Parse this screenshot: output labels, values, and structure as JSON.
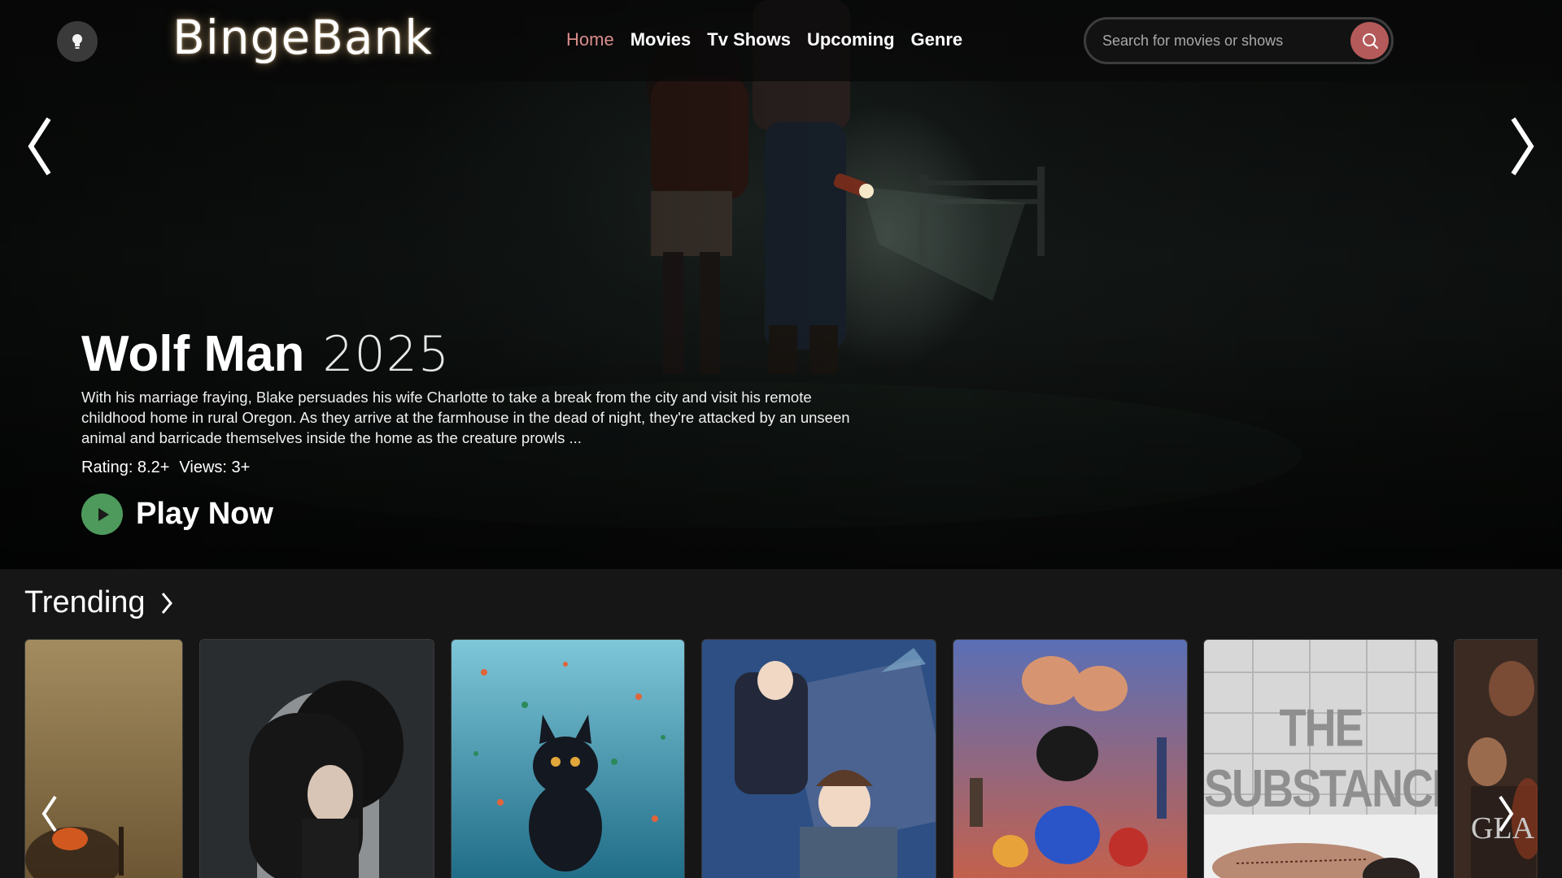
{
  "app": {
    "logo": "BingeBank"
  },
  "nav": {
    "links": [
      {
        "label": "Home",
        "active": true
      },
      {
        "label": "Movies"
      },
      {
        "label": "Tv Shows"
      },
      {
        "label": "Upcoming"
      },
      {
        "label": "Genre"
      }
    ],
    "search_placeholder": "Search for movies or shows",
    "accent_color": "#d98c8c"
  },
  "icons": {
    "theme_toggle": "lightbulb-icon",
    "search": "search-icon",
    "prev": "chevron-left-icon",
    "next": "chevron-right-icon",
    "play": "play-icon"
  },
  "hero": {
    "title": "Wolf Man",
    "year": "2025",
    "description": "With his marriage fraying, Blake persuades his wife Charlotte to take a break from the city and visit his remote childhood home in rural Oregon. As they arrive at the farmhouse in the dead of night, they're attacked by an unseen animal and barricade themselves inside the home as the creature prowls ...",
    "rating": "Rating: 8.2+",
    "views": "Views: 3+",
    "play_label": "Play Now",
    "play_color": "#4e9a5c"
  },
  "trending": {
    "title": "Trending",
    "cards": [
      {
        "name": "poster-1"
      },
      {
        "name": "poster-2"
      },
      {
        "name": "poster-3"
      },
      {
        "name": "poster-4"
      },
      {
        "name": "poster-5"
      },
      {
        "name": "poster-6",
        "text": "THE SUBSTANCE"
      },
      {
        "name": "poster-7",
        "text": "GLA"
      }
    ]
  }
}
